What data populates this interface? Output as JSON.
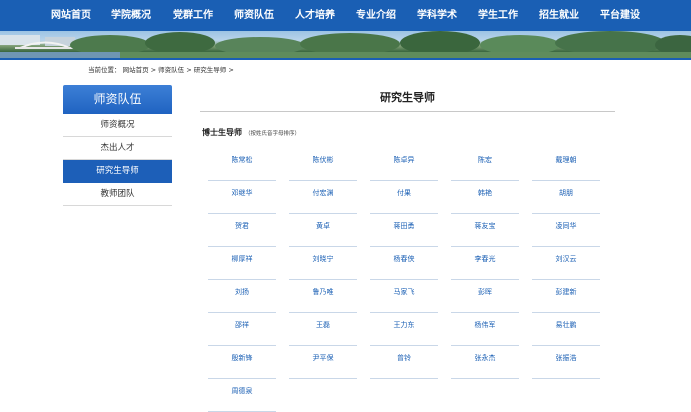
{
  "nav": {
    "items": [
      "网站首页",
      "学院概况",
      "党群工作",
      "师资队伍",
      "人才培养",
      "专业介绍",
      "学科学术",
      "学生工作",
      "招生就业",
      "平台建设"
    ]
  },
  "breadcrumb": {
    "prefix": "当前位置：",
    "items": [
      "网站首页",
      "师资队伍",
      "研究生导师"
    ],
    "sep": " > "
  },
  "sidebar": {
    "title": "师资队伍",
    "items": [
      {
        "label": "师资概况",
        "active": false
      },
      {
        "label": "杰出人才",
        "active": false
      },
      {
        "label": "研究生导师",
        "active": true
      },
      {
        "label": "教师团队",
        "active": false
      }
    ]
  },
  "main": {
    "title": "研究生导师",
    "section_title": "博士生导师",
    "section_note": "（按姓氏音字母排序）",
    "names": [
      "陈常松",
      "陈伏彬",
      "陈卓异",
      "陈宏",
      "戴理朝",
      "邓继华",
      "付宏渊",
      "付果",
      "韩艳",
      "胡朋",
      "贺君",
      "黄卓",
      "蒋田勇",
      "蒋友宝",
      "凌同华",
      "柳厚祥",
      "刘晓宁",
      "杨春侠",
      "李春光",
      "刘汉云",
      "刘扬",
      "鲁乃唯",
      "马家飞",
      "彭晖",
      "彭建新",
      "邵祥",
      "王磊",
      "王力东",
      "杨伟军",
      "易壮鹏",
      "殷新锋",
      "尹平保",
      "曾铃",
      "张永杰",
      "张振浩",
      "周德泉"
    ]
  },
  "colors": {
    "nav_bg": "#1a5fb4",
    "sidebar_active": "#1d5fb8",
    "link": "#1a5fb4"
  }
}
